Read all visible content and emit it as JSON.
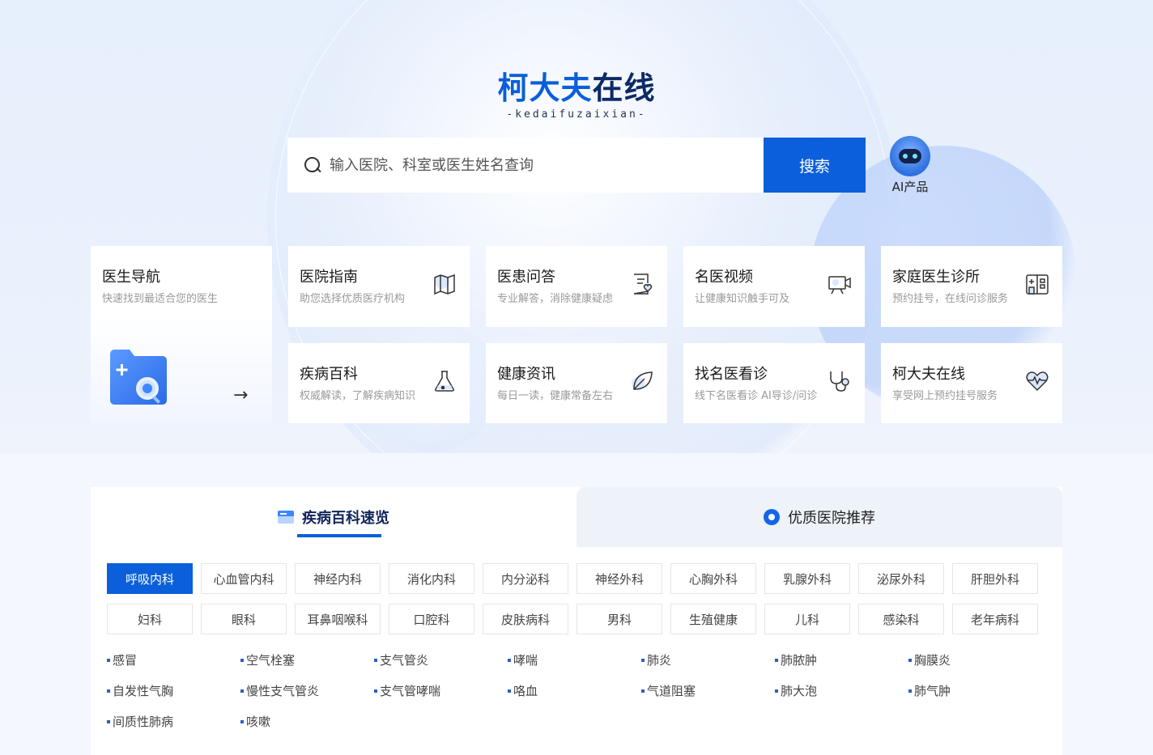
{
  "brand": {
    "title_part1": "柯大夫",
    "title_part2": "在线",
    "subtitle": "-kedaifuzaixian-"
  },
  "search": {
    "placeholder": "输入医院、科室或医生姓名查询",
    "button_label": "搜索"
  },
  "ai": {
    "label": "AI产品"
  },
  "doctor_nav": {
    "title": "医生导航",
    "desc": "快速找到最适合您的医生",
    "arrow": "→"
  },
  "nav_cards": [
    {
      "title": "医院指南",
      "desc": "助您选择优质医疗机构",
      "icon": "map-icon"
    },
    {
      "title": "医患问答",
      "desc": "专业解答，消除健康疑虑",
      "icon": "qa-document-icon"
    },
    {
      "title": "名医视频",
      "desc": "让健康知识触手可及",
      "icon": "video-camera-icon"
    },
    {
      "title": "家庭医生诊所",
      "desc": "预约挂号，在线问诊服务",
      "icon": "clinic-building-icon"
    },
    {
      "title": "疾病百科",
      "desc": "权威解读，了解疾病知识",
      "icon": "flask-icon"
    },
    {
      "title": "健康资讯",
      "desc": "每日一读，健康常备左右",
      "icon": "leaf-icon"
    },
    {
      "title": "找名医看诊",
      "desc": "线下名医看诊 AI导诊/问诊",
      "icon": "stethoscope-icon"
    },
    {
      "title": "柯大夫在线",
      "desc": "享受网上预约挂号服务",
      "icon": "heartbeat-icon"
    }
  ],
  "tabs": {
    "active": "疾病百科速览",
    "inactive": "优质医院推荐"
  },
  "departments": [
    "呼吸内科",
    "心血管内科",
    "神经内科",
    "消化内科",
    "内分泌科",
    "神经外科",
    "心胸外科",
    "乳腺外科",
    "泌尿外科",
    "肝胆外科",
    "妇科",
    "眼科",
    "耳鼻咽喉科",
    "口腔科",
    "皮肤病科",
    "男科",
    "生殖健康",
    "儿科",
    "感染科",
    "老年病科"
  ],
  "diseases": [
    "感冒",
    "空气栓塞",
    "支气管炎",
    "哮喘",
    "肺炎",
    "肺脓肿",
    "胸膜炎",
    "自发性气胸",
    "慢性支气管炎",
    "支气管哮喘",
    "咯血",
    "气道阻塞",
    "肺大泡",
    "肺气肿",
    "间质性肺病",
    "咳嗽"
  ],
  "colors": {
    "primary": "#0b5fdb",
    "brand_dark": "#0d2a66"
  }
}
